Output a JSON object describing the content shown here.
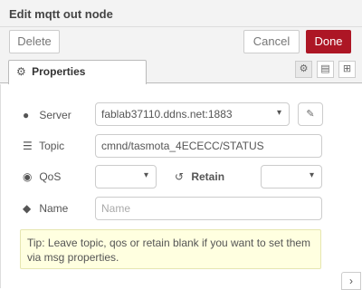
{
  "dialog": {
    "title": "Edit mqtt out node"
  },
  "toolbar": {
    "delete_label": "Delete",
    "cancel_label": "Cancel",
    "done_label": "Done"
  },
  "tabs": {
    "properties_label": "Properties"
  },
  "fields": {
    "server": {
      "label": "Server",
      "value": "fablab37110.ddns.net:1883"
    },
    "topic": {
      "label": "Topic",
      "value": "cmnd/tasmota_4ECECC/STATUS"
    },
    "qos": {
      "label": "QoS",
      "value": ""
    },
    "retain": {
      "label": "Retain",
      "value": ""
    },
    "name": {
      "label": "Name",
      "value": "",
      "placeholder": "Name"
    }
  },
  "tip": {
    "text": "Tip: Leave topic, qos or retain blank if you want to set them via msg properties."
  },
  "colors": {
    "done_button": "#ad1625",
    "tip_background": "#ffffe0"
  }
}
